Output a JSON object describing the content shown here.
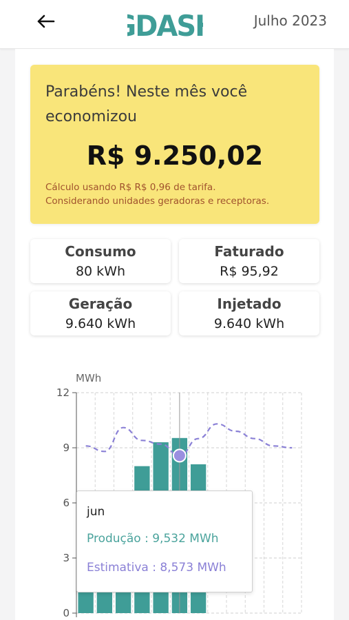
{
  "header": {
    "brand": "GDASH",
    "month": "Julho 2023",
    "back_icon": "arrow-left-icon"
  },
  "summary": {
    "message": "Parabéns! Neste mês você economizou",
    "amount": "R$ 9.250,02",
    "note_line1": "Cálculo usando R$ R$ 0,96 de tarifa.",
    "note_line2": "Considerando unidades geradoras e receptoras."
  },
  "stats": [
    {
      "label": "Consumo",
      "value": "80 kWh"
    },
    {
      "label": "Faturado",
      "value": "R$ 95,92"
    },
    {
      "label": "Geração",
      "value": "9.640 kWh"
    },
    {
      "label": "Injetado",
      "value": "9.640 kWh"
    }
  ],
  "colors": {
    "accent": "#3f9d97",
    "banner": "#f9e57a",
    "estimate": "#8a80d6",
    "note": "#a0522d"
  },
  "chart_data": {
    "type": "bar",
    "ylabel": "MWh",
    "ylim": [
      0,
      12
    ],
    "yticks": [
      "0",
      "3",
      "6",
      "9",
      "12"
    ],
    "grid": true,
    "series": [
      {
        "name": "Produção",
        "values": [
          1.2,
          1.2,
          1.2,
          8.0,
          9.3,
          9.532,
          8.1
        ]
      },
      {
        "name": "Estimativa",
        "values": [
          9.1,
          8.8,
          10.1,
          9.4,
          9.2,
          8.573,
          9.5,
          10.3,
          9.9,
          9.5,
          9.1,
          9.0
        ]
      }
    ],
    "highlight_index": 5
  },
  "tooltip": {
    "title": "jun",
    "row1": "Produção : 9,532 MWh",
    "row2": "Estimativa : 8,573 MWh"
  }
}
